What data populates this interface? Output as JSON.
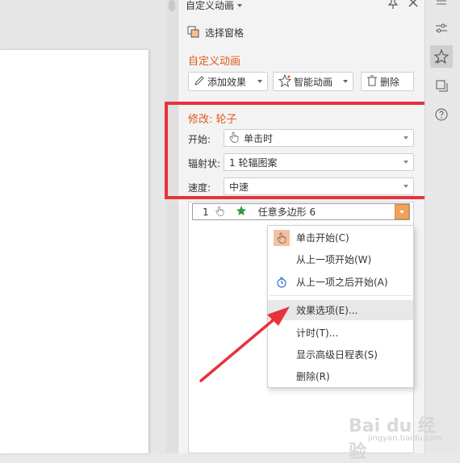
{
  "pane": {
    "title": "自定义动画",
    "select_pane": "选择窗格",
    "section_title": "自定义动画",
    "add_effect": "添加效果",
    "smart_animation": "智能动画",
    "delete": "删除"
  },
  "modify": {
    "title": "修改: 轮子",
    "start_label": "开始:",
    "start_value": "单击时",
    "spokes_label": "辐射状:",
    "spokes_value": "1 轮辐图案",
    "speed_label": "速度:",
    "speed_value": "中速"
  },
  "animation_list": {
    "item": {
      "index": "1",
      "name": "任意多边形 6"
    }
  },
  "context_menu": {
    "items": [
      "单击开始(C)",
      "从上一项开始(W)",
      "从上一项之后开始(A)",
      "效果选项(E)...",
      "计时(T)...",
      "显示高级日程表(S)",
      "删除(R)"
    ]
  },
  "watermark": {
    "brand": "Bai du 经验",
    "url": "jingyan.baidu.com"
  },
  "colors": {
    "accent": "#e05a1c",
    "highlight_box": "#e8323c",
    "star": "#2e9b3f",
    "dropdown_button": "#f0a15b"
  }
}
